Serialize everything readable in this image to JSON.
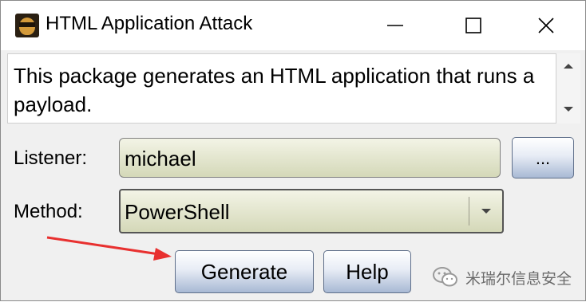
{
  "window": {
    "title": "HTML Application Attack",
    "controls": [
      "minimize-icon",
      "maximize-icon",
      "close-icon"
    ]
  },
  "description": "This package generates an HTML application that runs a payload.",
  "form": {
    "listener_label": "Listener:",
    "listener_value": "michael",
    "browse_label": "...",
    "method_label": "Method:",
    "method_value": "PowerShell"
  },
  "buttons": {
    "generate": "Generate",
    "help": "Help"
  },
  "watermark": {
    "text": "米瑞尔信息安全",
    "icon": "wechat-logo-icon"
  },
  "colors": {
    "field_top": "#f3f4e6",
    "field_bottom": "#d4d8b8",
    "button_bottom": "#a8b9d4",
    "annotation_arrow": "#e8302f"
  }
}
